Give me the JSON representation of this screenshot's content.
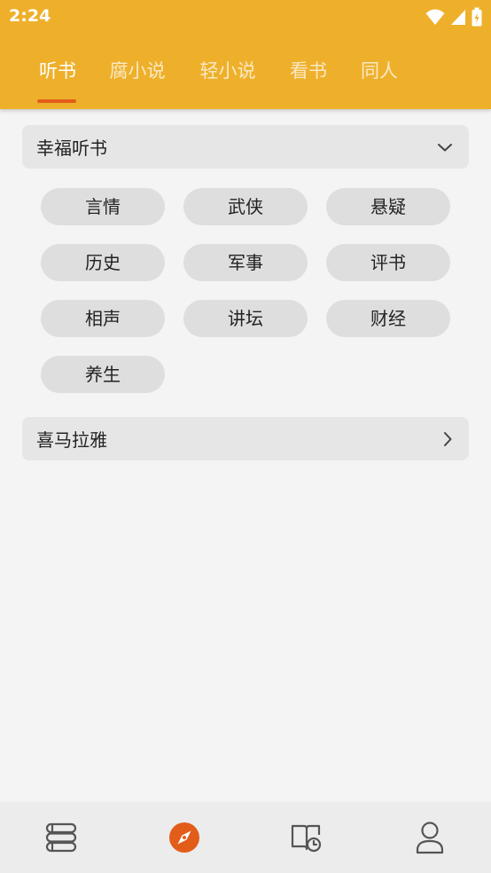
{
  "status_bar": {
    "time": "2:24"
  },
  "tabs": [
    {
      "label": "听书",
      "active": true
    },
    {
      "label": "腐小说",
      "active": false
    },
    {
      "label": "轻小说",
      "active": false
    },
    {
      "label": "看书",
      "active": false
    },
    {
      "label": "同人",
      "active": false
    }
  ],
  "sections": [
    {
      "title": "幸福听书",
      "expanded": true,
      "icon": "chevron-down-icon",
      "categories": [
        "言情",
        "武侠",
        "悬疑",
        "历史",
        "军事",
        "评书",
        "相声",
        "讲坛",
        "财经",
        "养生"
      ]
    },
    {
      "title": "喜马拉雅",
      "expanded": false,
      "icon": "chevron-right-icon"
    }
  ],
  "bottom_nav": [
    {
      "icon": "bookshelf-icon",
      "active": false
    },
    {
      "icon": "compass-discover-icon",
      "active": true
    },
    {
      "icon": "reading-history-icon",
      "active": false
    },
    {
      "icon": "profile-icon",
      "active": false
    }
  ],
  "colors": {
    "header": "#eeb02b",
    "accent": "#e25d1a",
    "background": "#f4f4f4",
    "chip": "#dedede",
    "section_bar": "#e6e6e6"
  }
}
